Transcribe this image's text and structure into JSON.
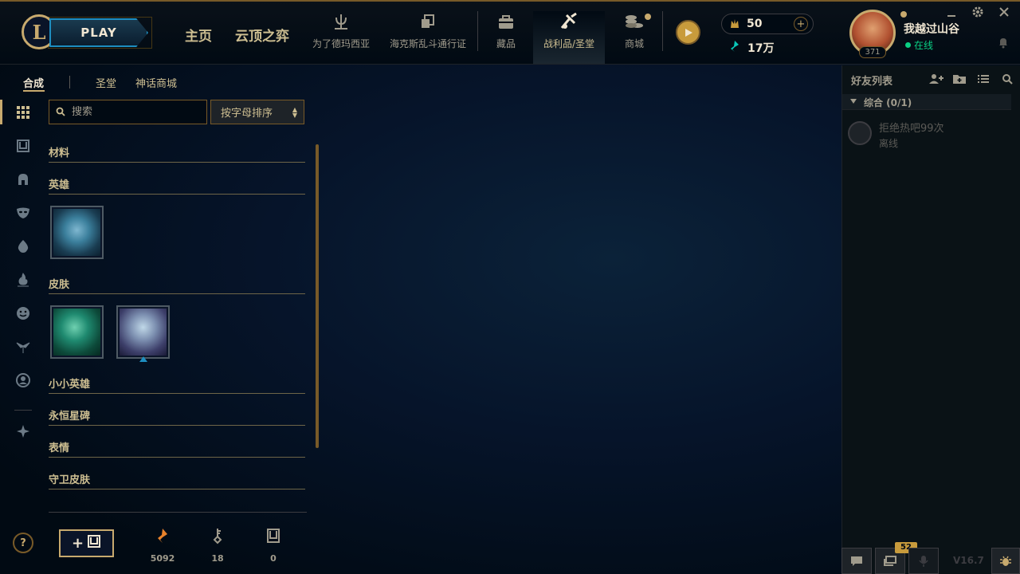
{
  "header": {
    "play_label": "PLAY",
    "nav_home": "主页",
    "nav_tft": "云顶之弈",
    "nav_items": [
      {
        "label": "为了德玛西亚",
        "icon": "demacia-icon"
      },
      {
        "label": "海克斯乱斗通行证",
        "icon": "pass-icon"
      },
      {
        "label": "藏品",
        "icon": "collection-icon"
      },
      {
        "label": "战利品/圣堂",
        "icon": "loot-icon"
      },
      {
        "label": "商城",
        "icon": "store-icon"
      }
    ],
    "active_nav": "战利品/圣堂",
    "rp_amount": "50",
    "blue_essence": "17万",
    "profile": {
      "username": "我越过山谷",
      "status": "在线",
      "level": "371"
    }
  },
  "subtabs": {
    "craft": "合成",
    "sanctum": "圣堂",
    "mythic_shop": "神话商城"
  },
  "search": {
    "placeholder": "搜索",
    "sort_label": "按字母排序"
  },
  "categories": {
    "materials": "材料",
    "champions": "英雄",
    "skins": "皮肤",
    "little_legends": "小小英雄",
    "eternals": "永恒星碑",
    "emotes": "表情",
    "ward_skins": "守卫皮肤"
  },
  "counters": {
    "orange_essence": "5092",
    "keys": "18",
    "chests": "0"
  },
  "friends": {
    "title": "好友列表",
    "group_label": "综合 (0/1)",
    "friend_name": "拒绝热吧99次",
    "friend_status": "离线"
  },
  "footer": {
    "notification_count": "52",
    "version": "V16.7"
  },
  "colors": {
    "gold": "#c8aa6e",
    "accent_blue": "#1e8ec0",
    "online_green": "#0acf83",
    "background": "#010a13"
  }
}
